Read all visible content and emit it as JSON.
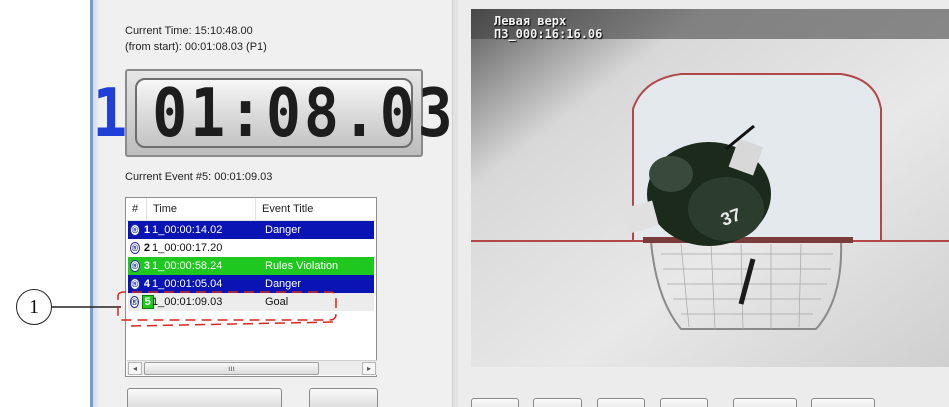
{
  "status": {
    "current_time": "Current Time: 15:10:48.00",
    "from_start": "(from start): 00:01:08.03 (P1)",
    "current_event": "Current Event #5: 00:01:09.03"
  },
  "clock": {
    "part": "1",
    "time": "01:08.03"
  },
  "event_list": {
    "headers": {
      "num": "#",
      "time": "Time",
      "title": "Event Title"
    },
    "rows": [
      {
        "icon": "®",
        "num": "1",
        "time": "1_00:00:14.02",
        "title": "Danger",
        "color": "#0a14b4"
      },
      {
        "icon": "®",
        "num": "2",
        "time": "1_00:00:17.20",
        "title": "",
        "color": "#ffffff"
      },
      {
        "icon": "®",
        "num": "3",
        "time": "1_00:00:58.24",
        "title": "Rules Violation",
        "color": "#1ec81e"
      },
      {
        "icon": "®",
        "num": "4",
        "time": "1_00:01:05.04",
        "title": "Danger",
        "color": "#0a14b4"
      },
      {
        "icon": "®",
        "num": "5",
        "time": "1_00:01:09.03",
        "title": "Goal",
        "color": "#ececec"
      }
    ],
    "scrollbar": {
      "left_arrow": "◂",
      "thumb_grip": "ııı",
      "right_arrow": "▸"
    }
  },
  "video": {
    "osd_line1": "Левая верх",
    "osd_line2": "ПЗ_000:16:16.06",
    "jersey_number": "37"
  },
  "annotation": {
    "callout": "1",
    "highlight_color": "#d9261c"
  },
  "colors": {
    "accent_blue": "#0a14b4",
    "accent_green": "#1ec81e",
    "clock_part_blue": "#1f3fd8"
  }
}
